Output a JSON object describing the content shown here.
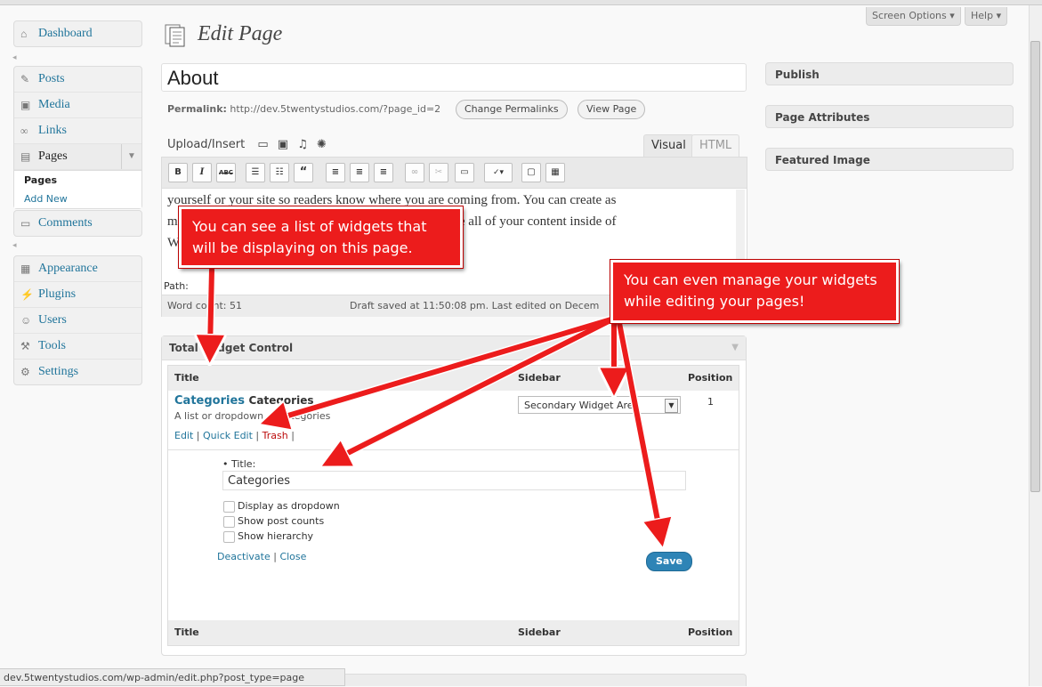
{
  "header": {
    "title": "Edit Page",
    "screen_options": "Screen Options",
    "help": "Help"
  },
  "sidebar": {
    "dashboard": "Dashboard",
    "items": [
      "Posts",
      "Media",
      "Links",
      "Pages"
    ],
    "submenu": [
      "Pages",
      "Add New"
    ],
    "comments": "Comments",
    "items2": [
      "Appearance",
      "Plugins",
      "Users",
      "Tools",
      "Settings"
    ]
  },
  "post": {
    "title": "About",
    "permalink_label": "Permalink:",
    "permalink_url": "http://dev.5twentystudios.com/?page_id=2",
    "change_permalinks": "Change Permalinks",
    "view_page": "View Page"
  },
  "editor": {
    "upload_insert": "Upload/Insert",
    "tab_visual": "Visual",
    "tab_html": "HTML",
    "line1": "yourself or your site so readers know where you are coming from. You can create as",
    "line2": "m                                                               te and manage all of your content inside of",
    "line3": "W",
    "path_label": "Path:",
    "word_count": "Word count: 51",
    "draft_saved": "Draft saved at 11:50:08 pm. Last edited on Decem"
  },
  "widget_control": {
    "title": "Total Widget Control",
    "col_title": "Title",
    "col_sidebar": "Sidebar",
    "col_position": "Position",
    "widget_name": "Categories",
    "widget_name2": "Categories",
    "widget_desc": "A list or dropdown of categories",
    "sidebar_value": "Secondary Widget Area",
    "position_value": "1",
    "action_edit": "Edit",
    "action_quick_edit": "Quick Edit",
    "action_trash": "Trash",
    "field_title_label": "Title:",
    "field_title_value": "Categories",
    "opt_dropdown": "Display as dropdown",
    "opt_counts": "Show post counts",
    "opt_hierarchy": "Show hierarchy",
    "deactivate": "Deactivate",
    "close": "Close",
    "save": "Save"
  },
  "right_panels": [
    "Publish",
    "Page Attributes",
    "Featured Image"
  ],
  "annotations": {
    "callout1": "You can see a list of widgets that will be displaying on this page.",
    "callout2": "You can even manage your widgets while editing your pages!"
  },
  "statusbar_url": "dev.5twentystudios.com/wp-admin/edit.php?post_type=page",
  "colors": {
    "link": "#21759b",
    "trash": "#bc0b0b",
    "callout": "#ec1c1c",
    "save_button": "#2e84b6"
  }
}
